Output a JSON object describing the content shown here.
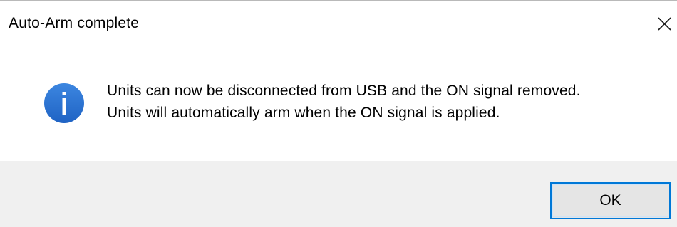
{
  "window": {
    "title": "Auto-Arm complete",
    "close_icon": "close-icon"
  },
  "message": {
    "icon": "info-icon",
    "icon_color": "#2a73d1",
    "lines": [
      "Units can now be disconnected from USB and the ON signal removed.",
      "Units will automatically arm when the ON signal is applied."
    ]
  },
  "buttons": {
    "ok_label": "OK",
    "ok_border_color": "#0078d7"
  },
  "colors": {
    "footer_background": "#f0f0f0",
    "dialog_background": "#ffffff"
  }
}
